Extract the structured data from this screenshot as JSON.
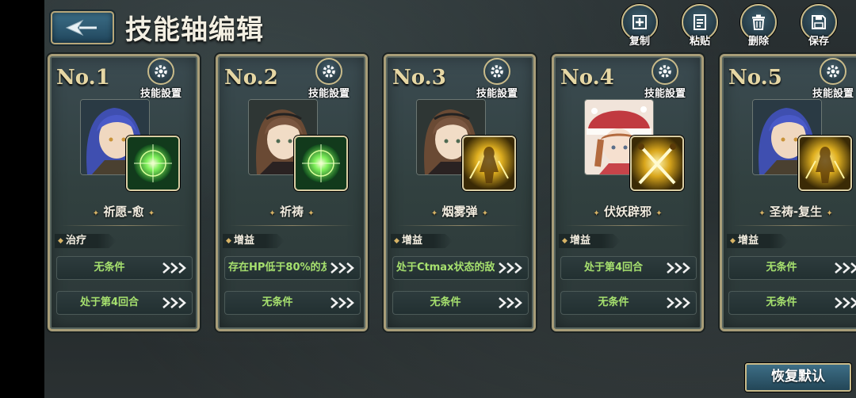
{
  "header": {
    "title": "技能轴编辑",
    "back_icon": "back-arrow-icon",
    "actions": [
      {
        "name": "copy",
        "label": "复制",
        "icon": "copy-icon"
      },
      {
        "name": "paste",
        "label": "粘贴",
        "icon": "paste-icon"
      },
      {
        "name": "delete",
        "label": "删除",
        "icon": "trash-icon"
      },
      {
        "name": "save",
        "label": "保存",
        "icon": "save-icon"
      }
    ]
  },
  "cards": [
    {
      "no": "No.1",
      "settings_label": "技能設置",
      "character": "blue-haired-girl",
      "skill_icon": "green-orb",
      "skill_name": "祈愿-愈",
      "category": "治疗",
      "conditions": [
        "无条件",
        "处于第4回合"
      ]
    },
    {
      "no": "No.2",
      "settings_label": "技能設置",
      "character": "brown-haired-girl",
      "skill_icon": "green-orb",
      "skill_name": "祈祷",
      "category": "增益",
      "conditions": [
        "存在HP低于80%的友",
        "无条件"
      ]
    },
    {
      "no": "No.3",
      "settings_label": "技能設置",
      "character": "brown-haired-girl",
      "skill_icon": "golden-warrior",
      "skill_name": "烟雾弹",
      "category": "增益",
      "conditions": [
        "处于Ctmax状态的敌",
        "无条件"
      ]
    },
    {
      "no": "No.4",
      "settings_label": "技能設置",
      "character": "red-hat-girl",
      "skill_icon": "crossed-swords",
      "skill_name": "伏妖辟邪",
      "category": "增益",
      "conditions": [
        "处于第4回合",
        "无条件"
      ]
    },
    {
      "no": "No.5",
      "settings_label": "技能設置",
      "character": "blue-haired-girl",
      "skill_icon": "golden-warrior",
      "skill_name": "圣祷-复生",
      "category": "增益",
      "conditions": [
        "无条件",
        "无条件"
      ]
    }
  ],
  "footer": {
    "restore_label": "恢复默认"
  },
  "colors": {
    "accent_gold": "#c9bb8a",
    "condition_text": "#a6e06e",
    "button_blue": "#2f5a70"
  }
}
